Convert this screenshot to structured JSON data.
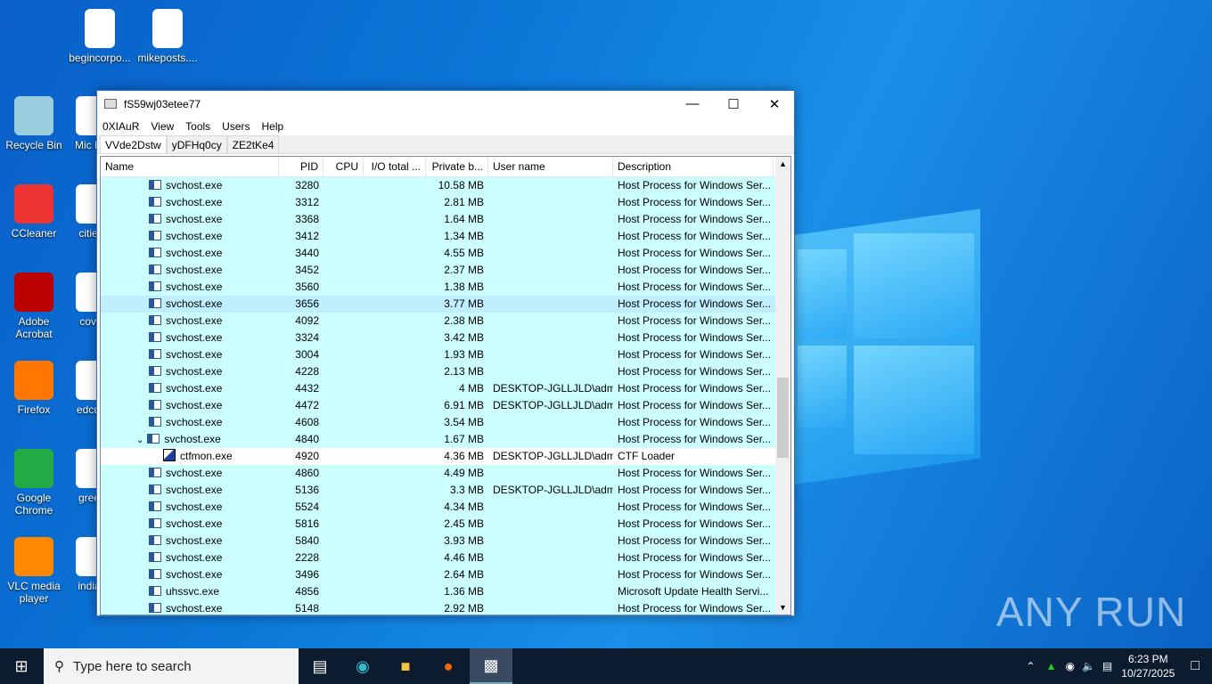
{
  "desktop": {
    "icons_col1": [
      "Recycle Bin",
      "CCleaner",
      "Adobe Acrobat",
      "Firefox",
      "Google Chrome",
      "VLC media player"
    ],
    "icons_col2": [
      "Mic Ec",
      "cities",
      "cove",
      "edcus",
      "greer",
      "indiar"
    ],
    "icons_top": [
      "begincorpo...",
      "mikeposts...."
    ],
    "watermark": "ANY RUN"
  },
  "window": {
    "title": "fS59wj03etee77",
    "menu": [
      "0XIAuR",
      "View",
      "Tools",
      "Users",
      "Help"
    ],
    "tabs": [
      "VVde2Dstw",
      "yDFHq0cy",
      "ZE2tKe4"
    ],
    "columns": [
      "Name",
      "PID",
      "CPU",
      "I/O total ...",
      "Private b...",
      "User name",
      "Description"
    ],
    "rows": [
      [
        "svchost.exe",
        "3280",
        "",
        "",
        "10.58 MB",
        "",
        "Host Process for Windows Ser..."
      ],
      [
        "svchost.exe",
        "3312",
        "",
        "",
        "2.81 MB",
        "",
        "Host Process for Windows Ser..."
      ],
      [
        "svchost.exe",
        "3368",
        "",
        "",
        "1.64 MB",
        "",
        "Host Process for Windows Ser..."
      ],
      [
        "svchost.exe",
        "3412",
        "",
        "",
        "1.34 MB",
        "",
        "Host Process for Windows Ser..."
      ],
      [
        "svchost.exe",
        "3440",
        "",
        "",
        "4.55 MB",
        "",
        "Host Process for Windows Ser..."
      ],
      [
        "svchost.exe",
        "3452",
        "",
        "",
        "2.37 MB",
        "",
        "Host Process for Windows Ser..."
      ],
      [
        "svchost.exe",
        "3560",
        "",
        "",
        "1.38 MB",
        "",
        "Host Process for Windows Ser..."
      ],
      [
        "svchost.exe",
        "3656",
        "",
        "",
        "3.77 MB",
        "",
        "Host Process for Windows Ser..."
      ],
      [
        "svchost.exe",
        "4092",
        "",
        "",
        "2.38 MB",
        "",
        "Host Process for Windows Ser..."
      ],
      [
        "svchost.exe",
        "3324",
        "",
        "",
        "3.42 MB",
        "",
        "Host Process for Windows Ser..."
      ],
      [
        "svchost.exe",
        "3004",
        "",
        "",
        "1.93 MB",
        "",
        "Host Process for Windows Ser..."
      ],
      [
        "svchost.exe",
        "4228",
        "",
        "",
        "2.13 MB",
        "",
        "Host Process for Windows Ser..."
      ],
      [
        "svchost.exe",
        "4432",
        "",
        "",
        "4 MB",
        "DESKTOP-JGLLJLD\\admi",
        "Host Process for Windows Ser..."
      ],
      [
        "svchost.exe",
        "4472",
        "",
        "",
        "6.91 MB",
        "DESKTOP-JGLLJLD\\admi",
        "Host Process for Windows Ser..."
      ],
      [
        "svchost.exe",
        "4608",
        "",
        "",
        "3.54 MB",
        "",
        "Host Process for Windows Ser..."
      ],
      [
        "svchost.exe",
        "4840",
        "",
        "",
        "1.67 MB",
        "",
        "Host Process for Windows Ser..."
      ],
      [
        "ctfmon.exe",
        "4920",
        "",
        "",
        "4.36 MB",
        "DESKTOP-JGLLJLD\\admi",
        "CTF Loader"
      ],
      [
        "svchost.exe",
        "4860",
        "",
        "",
        "4.49 MB",
        "",
        "Host Process for Windows Ser..."
      ],
      [
        "svchost.exe",
        "5136",
        "",
        "",
        "3.3 MB",
        "DESKTOP-JGLLJLD\\admi",
        "Host Process for Windows Ser..."
      ],
      [
        "svchost.exe",
        "5524",
        "",
        "",
        "4.34 MB",
        "",
        "Host Process for Windows Ser..."
      ],
      [
        "svchost.exe",
        "5816",
        "",
        "",
        "2.45 MB",
        "",
        "Host Process for Windows Ser..."
      ],
      [
        "svchost.exe",
        "5840",
        "",
        "",
        "3.93 MB",
        "",
        "Host Process for Windows Ser..."
      ],
      [
        "svchost.exe",
        "2228",
        "",
        "",
        "4.46 MB",
        "",
        "Host Process for Windows Ser..."
      ],
      [
        "svchost.exe",
        "3496",
        "",
        "",
        "2.64 MB",
        "",
        "Host Process for Windows Ser..."
      ],
      [
        "uhssvc.exe",
        "4856",
        "",
        "",
        "1.36 MB",
        "",
        "Microsoft Update Health Servi..."
      ],
      [
        "svchost.exe",
        "5148",
        "",
        "",
        "2.92 MB",
        "",
        "Host Process for Windows Ser..."
      ]
    ]
  },
  "taskbar": {
    "search_placeholder": "Type here to search",
    "time": "6:23 PM",
    "date": "10/27/2025"
  }
}
